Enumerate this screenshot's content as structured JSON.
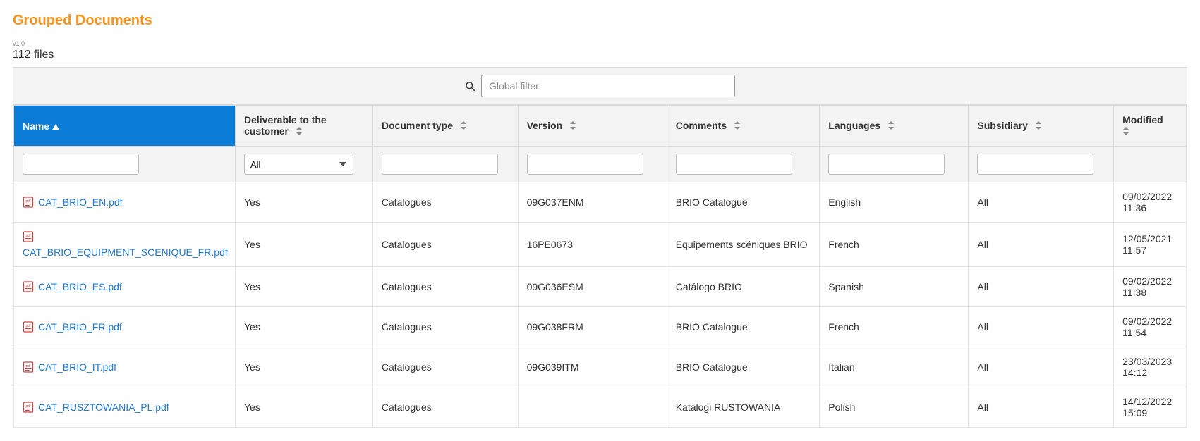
{
  "header": {
    "title": "Grouped Documents",
    "version": "v1.0",
    "file_count": "112 files"
  },
  "search": {
    "placeholder": "Global filter"
  },
  "columns": {
    "name": "Name",
    "deliverable": "Deliverable to the customer",
    "doctype": "Document type",
    "version": "Version",
    "comments": "Comments",
    "languages": "Languages",
    "subsidiary": "Subsidiary",
    "modified": "Modified"
  },
  "filters": {
    "deliverable_selected": "All"
  },
  "rows": [
    {
      "name": "CAT_BRIO_EN.pdf",
      "deliverable": "Yes",
      "doctype": "Catalogues",
      "version": "09G037ENM",
      "comments": "BRIO Catalogue",
      "languages": "English",
      "subsidiary": "All",
      "modified": "09/02/2022 11:36"
    },
    {
      "name": "CAT_BRIO_EQUIPMENT_SCENIQUE_FR.pdf",
      "deliverable": "Yes",
      "doctype": "Catalogues",
      "version": "16PE0673",
      "comments": "Equipements scéniques BRIO",
      "languages": "French",
      "subsidiary": "All",
      "modified": "12/05/2021 11:57"
    },
    {
      "name": "CAT_BRIO_ES.pdf",
      "deliverable": "Yes",
      "doctype": "Catalogues",
      "version": "09G036ESM",
      "comments": "Catálogo BRIO",
      "languages": "Spanish",
      "subsidiary": "All",
      "modified": "09/02/2022 11:38"
    },
    {
      "name": "CAT_BRIO_FR.pdf",
      "deliverable": "Yes",
      "doctype": "Catalogues",
      "version": "09G038FRM",
      "comments": "BRIO Catalogue",
      "languages": "French",
      "subsidiary": "All",
      "modified": "09/02/2022 11:54"
    },
    {
      "name": "CAT_BRIO_IT.pdf",
      "deliverable": "Yes",
      "doctype": "Catalogues",
      "version": "09G039ITM",
      "comments": "BRIO Catalogue",
      "languages": "Italian",
      "subsidiary": "All",
      "modified": "23/03/2023 14:12"
    },
    {
      "name": "CAT_RUSZTOWANIA_PL.pdf",
      "deliverable": "Yes",
      "doctype": "Catalogues",
      "version": "",
      "comments": "Katalogi RUSTOWANIA",
      "languages": "Polish",
      "subsidiary": "All",
      "modified": "14/12/2022 15:09"
    }
  ]
}
